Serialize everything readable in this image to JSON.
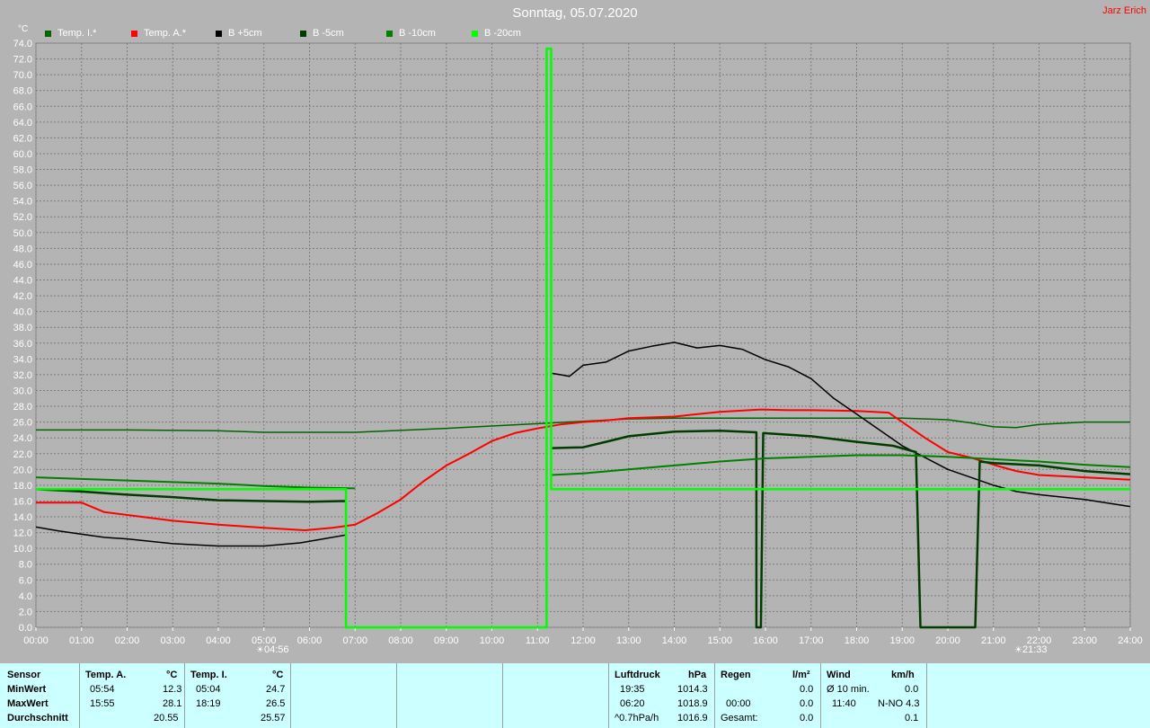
{
  "title": "Sonntag, 05.07.2020",
  "author": "Jarz Erich",
  "y_unit": "°C",
  "sunrise": {
    "time": "04:56",
    "icon": "sunrise-icon"
  },
  "sunset": {
    "time": "21:33",
    "icon": "sunset-icon"
  },
  "chart_data": {
    "type": "line",
    "x_ticks": [
      "00:00",
      "01:00",
      "02:00",
      "03:00",
      "04:00",
      "05:00",
      "06:00",
      "07:00",
      "08:00",
      "09:00",
      "10:00",
      "11:00",
      "12:00",
      "13:00",
      "14:00",
      "15:00",
      "16:00",
      "17:00",
      "18:00",
      "19:00",
      "20:00",
      "21:00",
      "22:00",
      "23:00",
      "24:00"
    ],
    "ylim": [
      0,
      74
    ],
    "y_step": 2,
    "grid": true,
    "legend_position": "top-left",
    "series": [
      {
        "name": "Temp. I.*",
        "color": "#006400",
        "width": 1.5,
        "points": [
          [
            0,
            25
          ],
          [
            2,
            25
          ],
          [
            4,
            24.9
          ],
          [
            5,
            24.7
          ],
          [
            7,
            24.7
          ],
          [
            9,
            25.2
          ],
          [
            11,
            25.8
          ],
          [
            12,
            26.1
          ],
          [
            13,
            26.4
          ],
          [
            14,
            26.5
          ],
          [
            17,
            26.5
          ],
          [
            19,
            26.5
          ],
          [
            20,
            26.3
          ],
          [
            20.5,
            25.9
          ],
          [
            21,
            25.4
          ],
          [
            21.5,
            25.3
          ],
          [
            22,
            25.7
          ],
          [
            23,
            26
          ],
          [
            24,
            26
          ]
        ]
      },
      {
        "name": "Temp. A.*",
        "color": "#ff0000",
        "width": 2,
        "points": [
          [
            0,
            15.8
          ],
          [
            1,
            15.8
          ],
          [
            1.5,
            14.6
          ],
          [
            3,
            13.5
          ],
          [
            4,
            13
          ],
          [
            5,
            12.6
          ],
          [
            5.9,
            12.3
          ],
          [
            6.5,
            12.6
          ],
          [
            7,
            13
          ],
          [
            7.5,
            14.5
          ],
          [
            8,
            16.2
          ],
          [
            8.5,
            18.5
          ],
          [
            9,
            20.5
          ],
          [
            9.5,
            22
          ],
          [
            10,
            23.6
          ],
          [
            10.5,
            24.6
          ],
          [
            11,
            25.2
          ],
          [
            11.5,
            25.7
          ],
          [
            12,
            26
          ],
          [
            12.5,
            26.2
          ],
          [
            13,
            26.5
          ],
          [
            14,
            26.7
          ],
          [
            15,
            27.3
          ],
          [
            15.9,
            27.6
          ],
          [
            16.5,
            27.5
          ],
          [
            17,
            27.5
          ],
          [
            18,
            27.4
          ],
          [
            18.7,
            27.2
          ],
          [
            19,
            26
          ],
          [
            19.5,
            24
          ],
          [
            20,
            22.2
          ],
          [
            20.5,
            21.5
          ],
          [
            21,
            20.6
          ],
          [
            21.5,
            19.8
          ],
          [
            22,
            19.3
          ],
          [
            23,
            19
          ],
          [
            24,
            18.7
          ]
        ]
      },
      {
        "name": "B +5cm",
        "color": "#000000",
        "width": 1.5,
        "points": [
          [
            0,
            12.7
          ],
          [
            0.5,
            12.2
          ],
          [
            1,
            11.8
          ],
          [
            1.5,
            11.4
          ],
          [
            2,
            11.2
          ],
          [
            3,
            10.6
          ],
          [
            4,
            10.3
          ],
          [
            5,
            10.3
          ],
          [
            5.8,
            10.7
          ],
          [
            6.3,
            11.2
          ],
          [
            6.8,
            11.7
          ],
          [
            6.8,
            8
          ],
          [
            6.8,
            null
          ],
          [
            11.3,
            32.2
          ],
          [
            11.5,
            32
          ],
          [
            11.7,
            31.8
          ],
          [
            12,
            33.2
          ],
          [
            12.5,
            33.6
          ],
          [
            13,
            35
          ],
          [
            13.5,
            35.6
          ],
          [
            14,
            36.1
          ],
          [
            14.5,
            35.4
          ],
          [
            15,
            35.7
          ],
          [
            15.5,
            35.2
          ],
          [
            16,
            33.9
          ],
          [
            16.5,
            33
          ],
          [
            17,
            31.5
          ],
          [
            17.5,
            29
          ],
          [
            18,
            27
          ],
          [
            18.5,
            25
          ],
          [
            19,
            23
          ],
          [
            19.5,
            21.5
          ],
          [
            20,
            20
          ],
          [
            20.5,
            19
          ],
          [
            21,
            18
          ],
          [
            21.5,
            17.2
          ],
          [
            22,
            16.8
          ],
          [
            23,
            16.2
          ],
          [
            24,
            15.3
          ]
        ]
      },
      {
        "name": "B -5cm",
        "color": "#003c00",
        "width": 2.5,
        "points": [
          [
            0,
            17.5
          ],
          [
            1,
            17.2
          ],
          [
            2,
            16.8
          ],
          [
            3,
            16.5
          ],
          [
            4,
            16.1
          ],
          [
            5,
            16
          ],
          [
            6,
            15.9
          ],
          [
            6.8,
            16
          ],
          [
            6.8,
            null
          ],
          [
            11.3,
            22.7
          ],
          [
            12,
            22.8
          ],
          [
            12.5,
            23.5
          ],
          [
            13,
            24.2
          ],
          [
            14,
            24.8
          ],
          [
            15,
            24.9
          ],
          [
            15.8,
            24.7
          ],
          [
            15.8,
            0
          ],
          [
            15.9,
            0
          ],
          [
            15.95,
            24.6
          ],
          [
            17,
            24.2
          ],
          [
            18,
            23.5
          ],
          [
            18.8,
            23
          ],
          [
            19.3,
            22.2
          ],
          [
            19.4,
            0
          ],
          [
            20.6,
            0
          ],
          [
            20.7,
            21
          ],
          [
            21,
            20.8
          ],
          [
            22,
            20.5
          ],
          [
            23,
            19.8
          ],
          [
            24,
            19.4
          ]
        ]
      },
      {
        "name": "B -10cm",
        "color": "#008000",
        "width": 2,
        "points": [
          [
            0,
            19
          ],
          [
            1,
            18.8
          ],
          [
            2,
            18.6
          ],
          [
            3,
            18.4
          ],
          [
            4,
            18.2
          ],
          [
            5,
            17.9
          ],
          [
            6,
            17.7
          ],
          [
            7,
            17.6
          ],
          [
            7,
            null
          ],
          [
            11.3,
            19.3
          ],
          [
            12,
            19.5
          ],
          [
            13,
            20
          ],
          [
            14,
            20.5
          ],
          [
            15,
            21
          ],
          [
            16,
            21.4
          ],
          [
            17,
            21.6
          ],
          [
            18,
            21.8
          ],
          [
            19,
            21.8
          ],
          [
            20,
            21.6
          ],
          [
            21,
            21.3
          ],
          [
            22,
            21
          ],
          [
            23,
            20.6
          ],
          [
            24,
            20.3
          ]
        ]
      },
      {
        "name": "B -20cm",
        "color": "#00ff00",
        "width": 2.5,
        "points": [
          [
            0,
            17.5
          ],
          [
            6.8,
            17.5
          ],
          [
            6.8,
            0
          ],
          [
            11.2,
            0
          ],
          [
            11.2,
            73.3
          ],
          [
            11.3,
            73.3
          ],
          [
            11.3,
            17.5
          ],
          [
            24,
            17.5
          ]
        ]
      }
    ]
  },
  "stats": {
    "sensor": {
      "header": "Sensor",
      "rows": [
        "MinWert",
        "MaxWert",
        "Durchschnitt"
      ]
    },
    "temp_a": {
      "header": "Temp. A.",
      "unit": "°C",
      "min_time": "05:54",
      "min": "12.3",
      "max_time": "15:55",
      "max": "28.1",
      "avg": "20.55"
    },
    "temp_i": {
      "header": "Temp. I.",
      "unit": "°C",
      "min_time": "05:04",
      "min": "24.7",
      "max_time": "18:19",
      "max": "26.5",
      "avg": "25.57"
    },
    "pressure": {
      "header": "Luftdruck",
      "unit": "hPa",
      "min_time": "19:35",
      "min": "1014.3",
      "max_time": "06:20",
      "max": "1018.9",
      "trend_label": "^0.7hPa/h",
      "current": "1016.9"
    },
    "rain": {
      "header": "Regen",
      "unit": "l/m²",
      "time": "00:00",
      "value": "0.0",
      "total_label": "Gesamt:",
      "total": "0.0",
      "first": "0.0"
    },
    "wind": {
      "header": "Wind",
      "unit": "km/h",
      "avg_label": "Ø 10 min.",
      "avg": "0.0",
      "max_time": "11:40",
      "max": "N-NO 4.3",
      "last": "0.1"
    }
  }
}
